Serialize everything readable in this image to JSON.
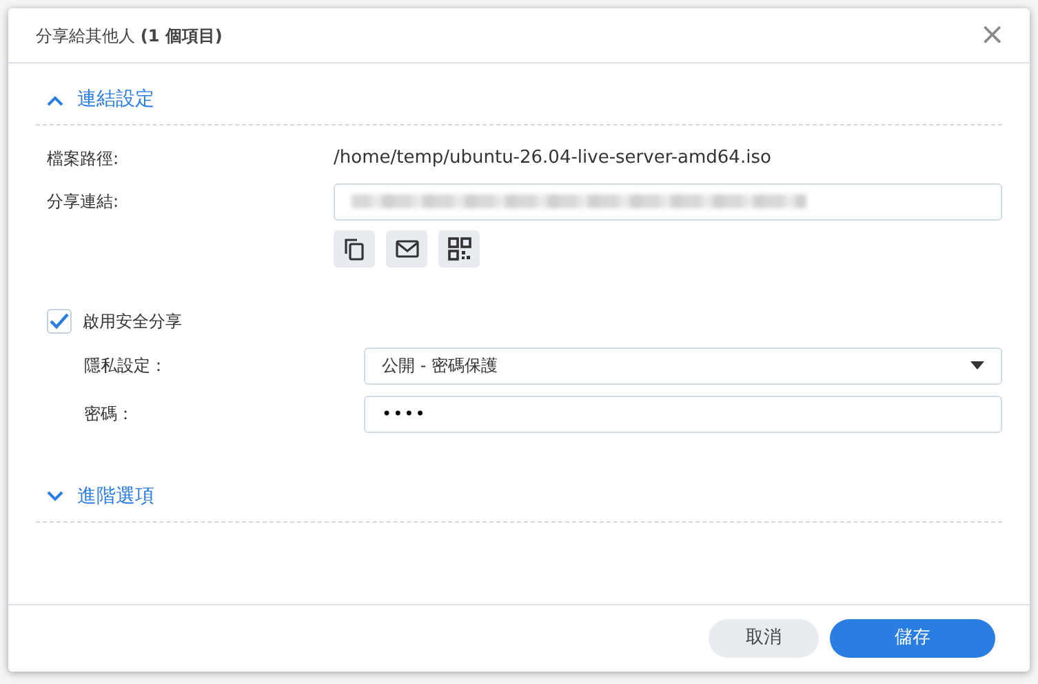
{
  "window": {
    "title": "分享給其他人 **(1 個項目)**",
    "close": "×"
  },
  "sections": [
    {
      "title": "連結設定",
      "expanded": true,
      "fields": [
        {
          "kind": "text",
          "label": "檔案路徑:",
          "value": "/home/temp/ubuntu-26.04-live-server-amd64.iso"
        },
        {
          "kind": "link",
          "label": "分享連結:"
        }
      ]
    },
    {
      "title": "進階選項",
      "expanded": false
    }
  ],
  "secure_share": {
    "label": "啟用安全分享",
    "checked": true,
    "fields": [
      {
        "kind": "select",
        "label": "隱私設定：",
        "value": "公開 - 密碼保護"
      },
      {
        "kind": "password",
        "label": "密碼：",
        "value": "••••"
      }
    ]
  },
  "buttons": [
    {
      "label": "取消",
      "kind": "secondary"
    },
    {
      "label": "儲存",
      "kind": "primary"
    }
  ]
}
